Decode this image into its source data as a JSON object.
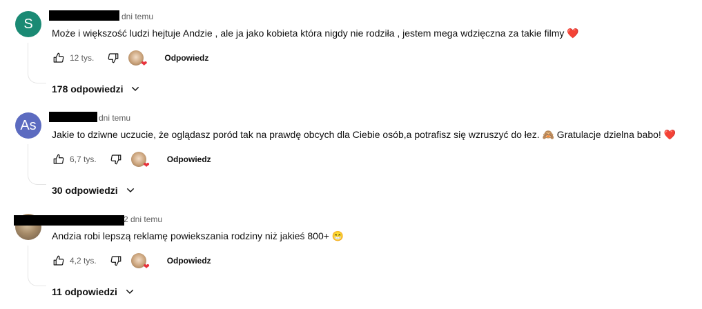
{
  "comments": [
    {
      "avatar_letter": "S",
      "avatar_color": "#1a8a74",
      "time": "dni temu",
      "text": "Może i większość ludzi hejtuje Andzie , ale ja jako kobieta która nigdy nie rodziła , jestem mega wdzięczna za takie filmy",
      "emoji": "❤️",
      "likes": "12 tys.",
      "reply_label": "Odpowiedz",
      "replies_label": "178 odpowiedzi"
    },
    {
      "avatar_letter": "As",
      "avatar_color": "#5c6bc0",
      "time": "dni temu",
      "text": "Jakie to dziwne uczucie, że oglądasz poród tak na prawdę obcych dla Ciebie osób,a potrafisz się wzruszyć do łez. 🙈 Gratulacje dzielna babo!",
      "emoji": "❤️",
      "likes": "6,7 tys.",
      "reply_label": "Odpowiedz",
      "replies_label": "30 odpowiedzi"
    },
    {
      "avatar_letter": "",
      "avatar_color": "#a58a68",
      "time": "2 dni temu",
      "text": "Andzia robi lepszą reklamę powiekszania rodziny niż jakieś 800+",
      "emoji": "😁",
      "likes": "4,2 tys.",
      "reply_label": "Odpowiedz",
      "replies_label": "11 odpowiedzi"
    }
  ],
  "icons": {
    "like": "thumb-up-icon",
    "dislike": "thumb-down-icon",
    "expand": "chevron-down-icon",
    "creator_heart": "heart-icon"
  },
  "colors": {
    "heart": "#e8323b",
    "secondary_text": "#606060"
  }
}
